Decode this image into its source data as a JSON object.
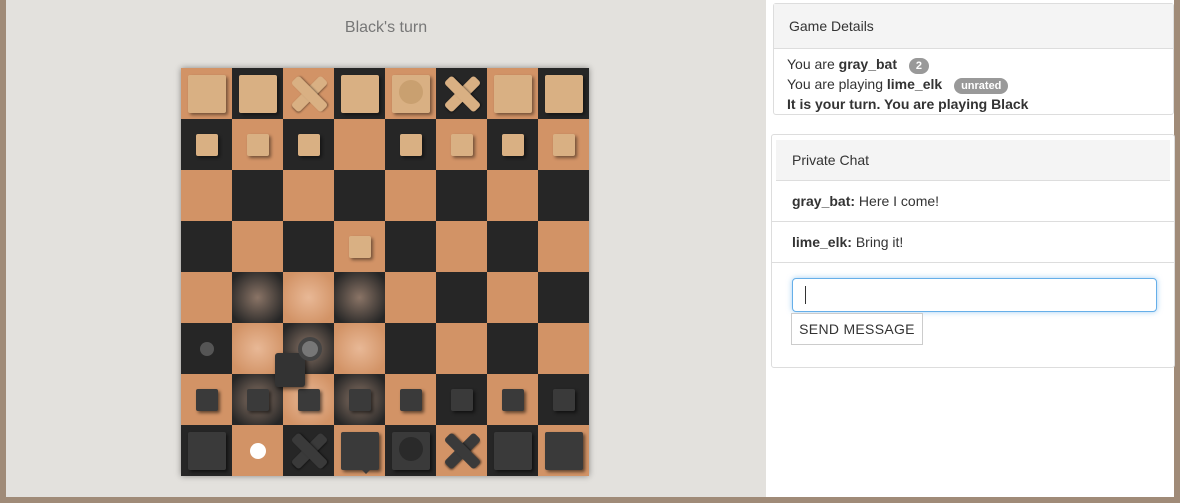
{
  "status": {
    "turn_label": "Black's turn"
  },
  "board": {
    "rows": [
      [
        "lb-rook",
        "lb-knight",
        "lb-x",
        "lb-king",
        "lb-queen",
        "lb-x",
        "lb-knight",
        "lb-rook"
      ],
      [
        "lb-pawn",
        "lb-pawn",
        "lb-pawn",
        "",
        "lb-pawn",
        "lb-pawn",
        "lb-pawn",
        "lb-pawn"
      ],
      [
        "",
        "",
        "",
        "",
        "",
        "",
        "",
        ""
      ],
      [
        "",
        "",
        "",
        "lb-pawn",
        "",
        "",
        "",
        ""
      ],
      [
        "",
        "",
        "",
        "",
        "",
        "",
        "",
        ""
      ],
      [
        "dot",
        "",
        "sel",
        "",
        "",
        "",
        "",
        ""
      ],
      [
        "dk-pawn",
        "dk-pawn",
        "dk-pawn",
        "dk-pawn",
        "dk-pawn",
        "dk-pawn",
        "dk-pawn",
        "dk-pawn"
      ],
      [
        "dk-rook",
        "wdot",
        "dk-x",
        "dk-king",
        "dk-queen",
        "dk-x",
        "dk-knight",
        "dk-rook"
      ]
    ]
  },
  "details": {
    "title": "Game Details",
    "you_are_prefix": "You are",
    "player_name": "gray_bat",
    "player_badge": "2",
    "playing_prefix": "You are playing",
    "opponent_name": "lime_elk",
    "opponent_badge": "unrated",
    "turn_notice": "It is your turn. You are playing Black"
  },
  "chat": {
    "title": "Private Chat",
    "messages": [
      {
        "user": "gray_bat:",
        "text": "Here I come!"
      },
      {
        "user": "lime_elk:",
        "text": "Bring it!"
      }
    ],
    "input_value": "",
    "send_label": "SEND MESSAGE"
  }
}
